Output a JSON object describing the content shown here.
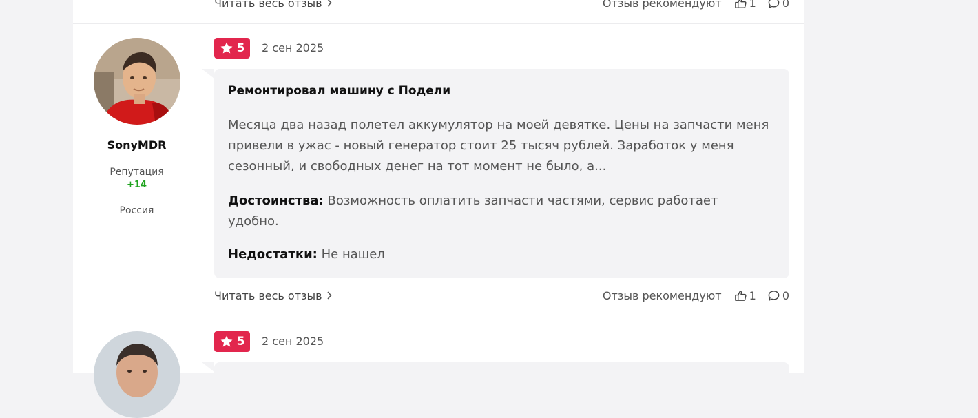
{
  "top_footer": {
    "read_more": "Читать весь отзыв",
    "recommend_label": "Отзыв рекомендуют",
    "likes": "1",
    "comments": "0"
  },
  "review1": {
    "rating": "5",
    "date": "2 сен 2025",
    "user": {
      "name": "SonyMDR",
      "reputation_label": "Репутация",
      "reputation_value": "+14",
      "country": "Россия"
    },
    "title": "Ремонтировал машину с Подели",
    "text": "Месяца два назад полетел аккумулятор на моей девятке. Цены на запчасти меня привели в ужас - новый генератор стоит 25 тысяч рублей. Заработок у меня сезонный, и свободных денег на тот момент не было, а...",
    "pros_label": "Достоинства:",
    "pros": "Возможность оплатить запчасти частями, сервис работает удобно.",
    "cons_label": "Недостатки:",
    "cons": "Не нашел",
    "footer": {
      "read_more": "Читать весь отзыв",
      "recommend_label": "Отзыв рекомендуют",
      "likes": "1",
      "comments": "0"
    }
  },
  "review2": {
    "rating": "5",
    "date": "2 сен 2025"
  },
  "colors": {
    "badge": "#e2264d",
    "reputation_positive": "#1fa31f",
    "bubble": "#f3f3f5"
  },
  "icons": [
    "star-icon",
    "chevron-right-icon",
    "thumbs-up-icon",
    "comment-icon"
  ]
}
